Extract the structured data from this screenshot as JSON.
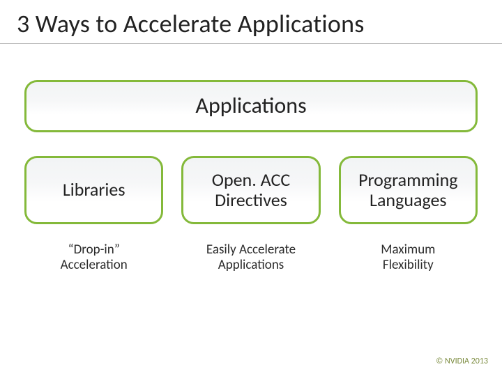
{
  "title": "3 Ways to Accelerate Applications",
  "top_box": "Applications",
  "cards": [
    {
      "label": "Libraries",
      "caption": "“Drop-in”\nAcceleration"
    },
    {
      "label": "Open. ACC\nDirectives",
      "caption": "Easily Accelerate\nApplications"
    },
    {
      "label": "Programming\nLanguages",
      "caption": "Maximum\nFlexibility"
    }
  ],
  "footer": "© NVIDIA 2013"
}
